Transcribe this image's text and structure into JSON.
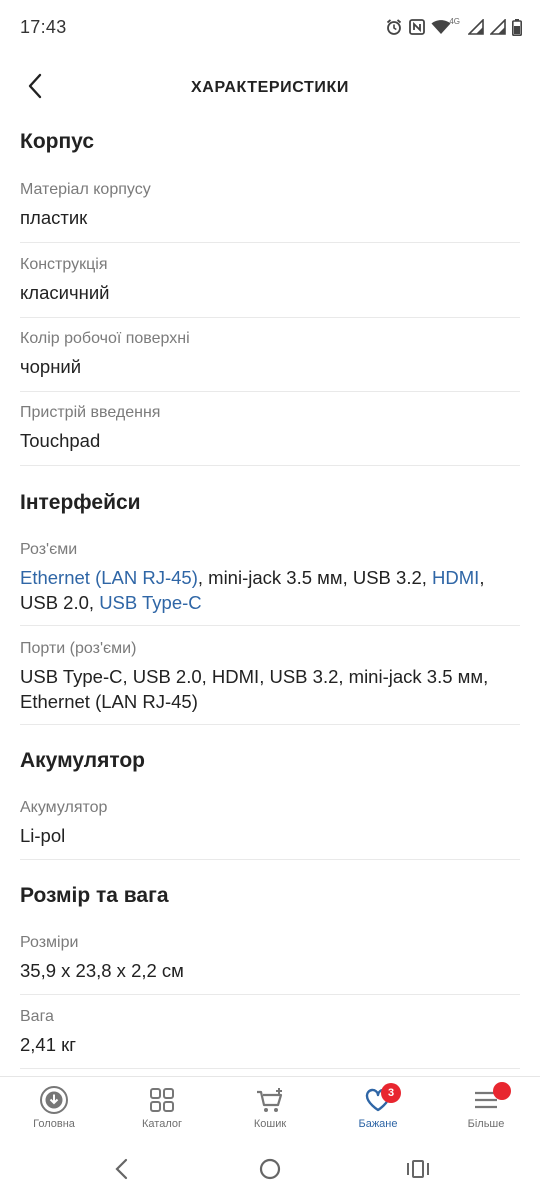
{
  "status_bar": {
    "time": "17:43",
    "network_label": "4G",
    "icons": [
      "alarm-icon",
      "nfc-icon",
      "wifi-icon",
      "signal-icon",
      "signal-icon",
      "battery-icon"
    ]
  },
  "header": {
    "title": "ХАРАКТЕРИСТИКИ",
    "back_icon": "chevron-left-icon"
  },
  "sections": [
    {
      "title": "Корпус",
      "rows": [
        {
          "label": "Матеріал корпусу",
          "value": "пластик"
        },
        {
          "label": "Конструкція",
          "value": "класичний"
        },
        {
          "label": "Колір робочої поверхні",
          "value": "чорний"
        },
        {
          "label": "Пристрій введення",
          "value": "Touchpad"
        }
      ]
    },
    {
      "title": "Інтерфейси",
      "rows": [
        {
          "label": "Роз'єми",
          "parts": [
            {
              "text": "Ethernet (LAN RJ-45)",
              "link": true
            },
            {
              "text": ", mini-jack 3.5 мм, USB 3.2, ",
              "link": false
            },
            {
              "text": "HDMI",
              "link": true
            },
            {
              "text": ", USB 2.0, ",
              "link": false
            },
            {
              "text": "USB Type-C",
              "link": true
            }
          ]
        },
        {
          "label": "Порти (роз'єми)",
          "value": "USB Type-C, USB 2.0, HDMI, USB 3.2, mini-jack 3.5 мм, Ethernet (LAN RJ-45)"
        }
      ]
    },
    {
      "title": "Акумулятор",
      "rows": [
        {
          "label": "Акумулятор",
          "value": "Li-pol"
        }
      ]
    },
    {
      "title": "Розмір та вага",
      "rows": [
        {
          "label": "Розміри",
          "value": "35,9 х 23,8 х 2,2 см"
        },
        {
          "label": "Вага",
          "value": "2,41 кг"
        }
      ]
    }
  ],
  "bottom_nav": {
    "items": [
      {
        "label": "Головна",
        "icon": "home-icon",
        "active": false
      },
      {
        "label": "Каталог",
        "icon": "grid-icon",
        "active": false
      },
      {
        "label": "Кошик",
        "icon": "cart-icon",
        "active": false
      },
      {
        "label": "Бажане",
        "icon": "heart-icon",
        "active": true,
        "badge": "3"
      },
      {
        "label": "Більше",
        "icon": "menu-icon",
        "active": false,
        "dot": true
      }
    ]
  },
  "colors": {
    "accent": "#2f66a6",
    "badge": "#e8262f",
    "label": "#7b7b7b",
    "text": "#222222"
  }
}
